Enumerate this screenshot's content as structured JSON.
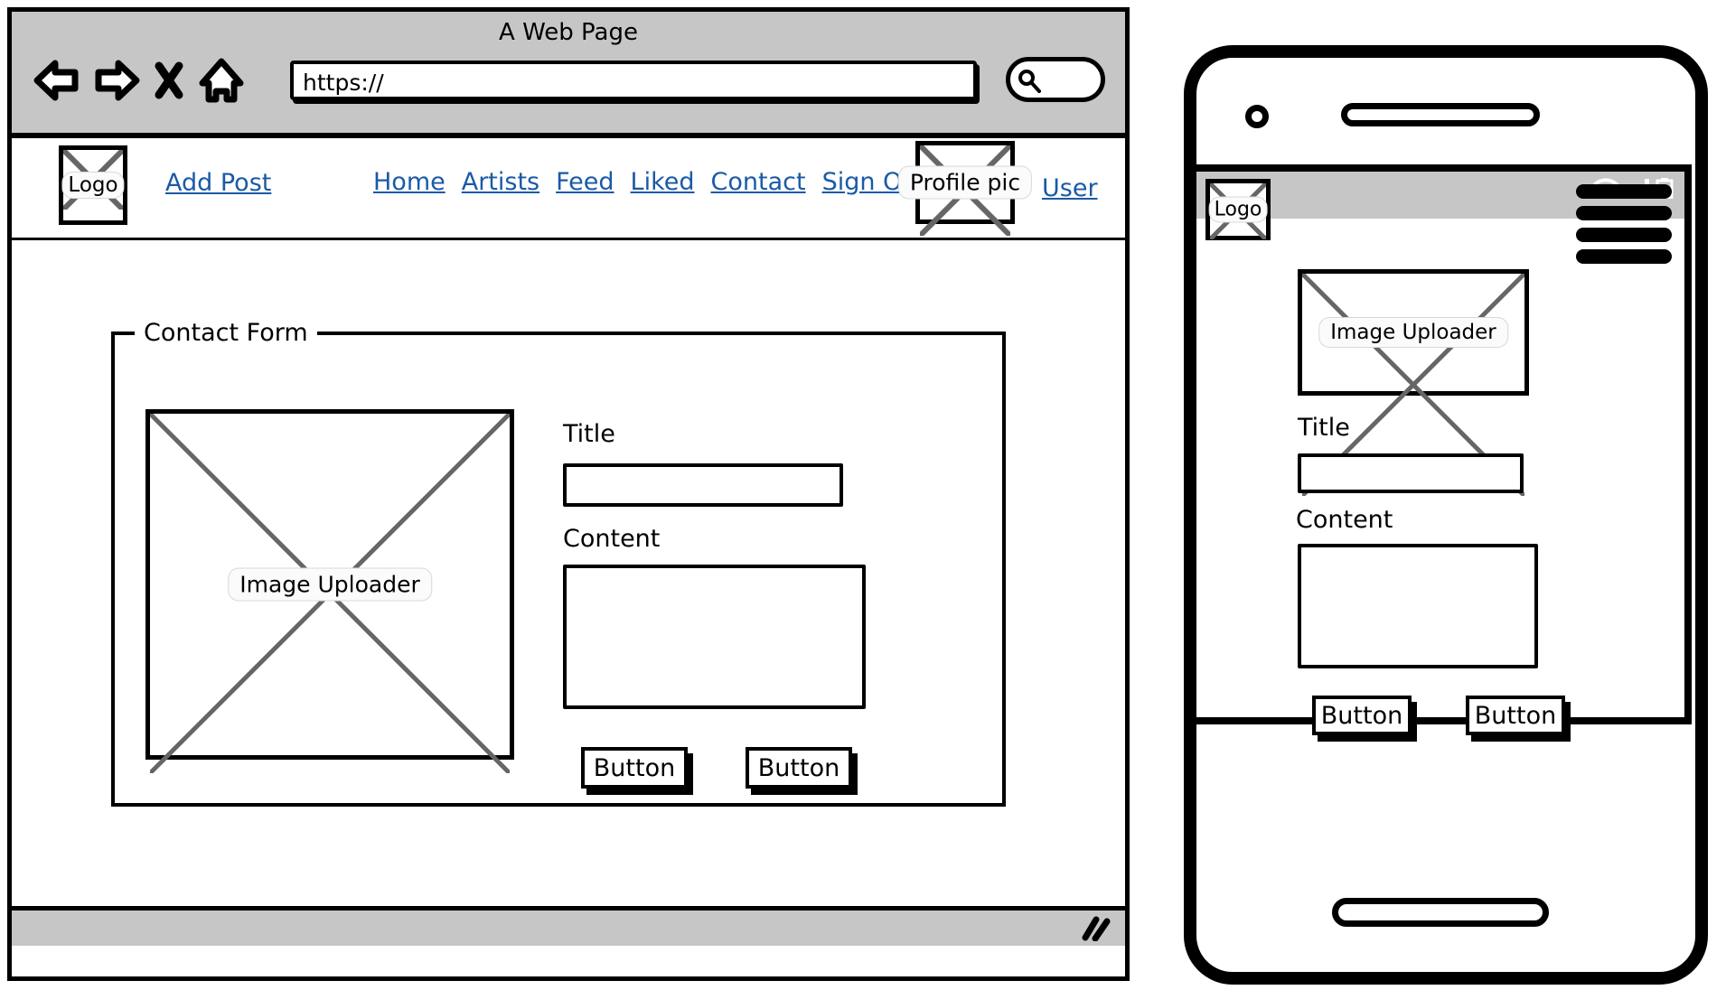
{
  "browser": {
    "window_title": "A Web Page",
    "url_value": "https://",
    "url_placeholder": "https://",
    "toolbar_icons": [
      {
        "name": "back-icon",
        "label": "Back"
      },
      {
        "name": "forward-icon",
        "label": "Forward"
      },
      {
        "name": "stop-icon",
        "label": "Stop"
      },
      {
        "name": "home-icon",
        "label": "Home"
      }
    ],
    "search_icon": "search-icon",
    "search_value": "",
    "resize_grip": "resize-grip-icon"
  },
  "site_header": {
    "logo_label": "Logo",
    "add_post_label": "Add Post",
    "nav_links": [
      {
        "label": "Home"
      },
      {
        "label": "Artists"
      },
      {
        "label": "Feed"
      },
      {
        "label": "Liked"
      },
      {
        "label": "Contact"
      },
      {
        "label": "Sign Out"
      }
    ],
    "profile_pic_label": "Profile pic",
    "user_label": "User"
  },
  "contact_form": {
    "group_title": "Contact Form",
    "image_uploader_label": "Image Uploader",
    "title_label": "Title",
    "title_value": "",
    "content_label": "Content",
    "content_value": "",
    "buttons": [
      {
        "label": "Button"
      },
      {
        "label": "Button"
      }
    ]
  },
  "mobile": {
    "status_icons": [
      {
        "name": "wifi-icon"
      },
      {
        "name": "signal-bars-icon"
      },
      {
        "name": "battery-icon"
      }
    ],
    "logo_label": "Logo",
    "menu_icon": "hamburger-menu-icon",
    "image_uploader_label": "Image Uploader",
    "title_label": "Title",
    "title_value": "",
    "content_label": "Content",
    "content_value": "",
    "buttons": [
      {
        "label": "Button"
      },
      {
        "label": "Button"
      }
    ],
    "camera_icon": "camera-icon",
    "speaker_icon": "speaker-icon",
    "home_button_icon": "home-button-icon"
  },
  "colors": {
    "chrome_gray": "#c6c6c6",
    "link_blue": "#1a5aa6",
    "ink": "#000000",
    "cross_gray": "#666666"
  }
}
